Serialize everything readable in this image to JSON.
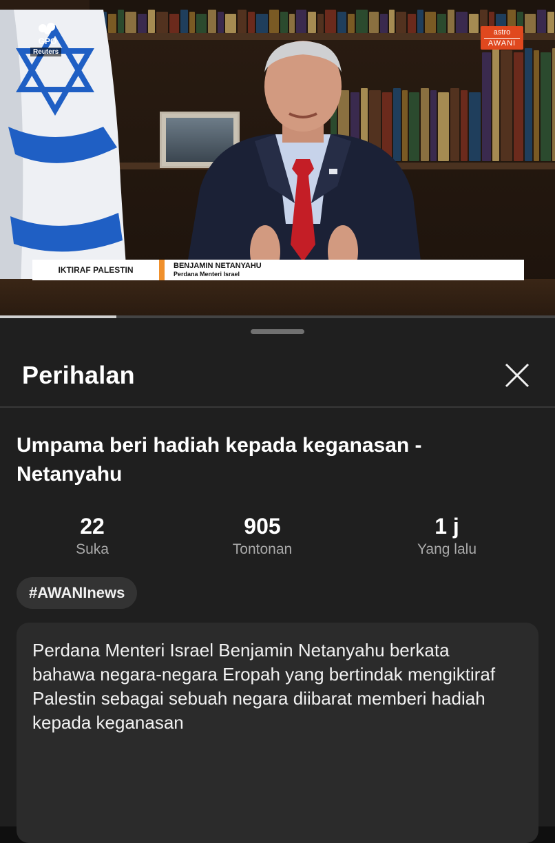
{
  "video": {
    "source_logo": "GPO",
    "source_credit": "Reuters",
    "channel_logo_top": "astro",
    "channel_logo_bottom": "AWANI",
    "lower_third_tag": "IKTIRAF PALESTIN",
    "lower_third_name": "BENJAMIN NETANYAHU",
    "lower_third_role": "Perdana Menteri Israel",
    "progress_fraction": 0.21
  },
  "sheet": {
    "header_title": "Perihalan",
    "close_icon": "close-x-icon",
    "video_title": "Umpama beri hadiah kepada keganasan - Netanyahu",
    "stats": [
      {
        "value": "22",
        "label": "Suka"
      },
      {
        "value": "905",
        "label": "Tontonan"
      },
      {
        "value": "1 j",
        "label": "Yang lalu"
      }
    ],
    "hashtag": "#AWANInews",
    "description": "Perdana Menteri Israel Benjamin Netanyahu berkata bahawa negara-negara Eropah yang bertindak mengiktiraf Palestin sebagai sebuah negara diibarat memberi hadiah kepada keganasan"
  },
  "colors": {
    "background": "#0f0f0f",
    "sheet": "#1f1f1f",
    "chip": "#333333",
    "description_box": "#2b2b2b",
    "secondary_text": "#aaaaaa",
    "lower_third_accent": "#f0902c",
    "channel_logo": "#e0481e",
    "flag_blue": "#1f5fc4"
  }
}
